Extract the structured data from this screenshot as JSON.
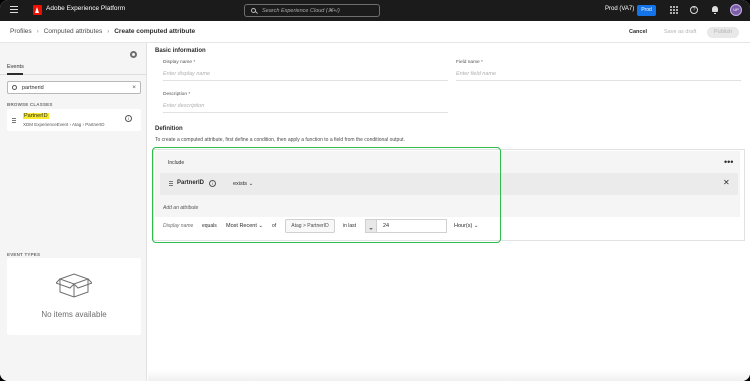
{
  "app": {
    "brand": "Adobe Experience Platform",
    "search_placeholder": "Search Experience Cloud (⌘+/)",
    "org": "Prod (VA7)",
    "sandbox_badge": "Prod",
    "help_glyph": "?",
    "avatar_initials": "UP"
  },
  "breadcrumb": {
    "items": [
      "Profiles",
      "Computed attributes",
      "Create computed attribute"
    ],
    "separator": "›"
  },
  "header_actions": {
    "cancel": "Cancel",
    "save_draft": "Save as draft",
    "publish": "Publish"
  },
  "left_panel": {
    "tab": "Events",
    "search_value": "partnerid",
    "clear_glyph": "×",
    "browse_classes_label": "BROWSE CLASSES",
    "class_item": {
      "name": "PartnerID",
      "path": "XDM ExperienceEvent › Atag › PartnerID",
      "info_glyph": "i"
    },
    "event_types_label": "EVENT TYPES",
    "empty_text": "No items available"
  },
  "form": {
    "basic_info_title": "Basic information",
    "display_name_label": "Display name *",
    "display_name_placeholder": "Enter display name",
    "field_name_label": "Field name *",
    "field_name_placeholder": "Enter field name",
    "description_label": "Description *",
    "description_placeholder": "Enter description",
    "definition_title": "Definition",
    "definition_description": "To create a computed attribute, first define a condition, then apply a function to a field from the conditional output."
  },
  "definition": {
    "include_label": "Include",
    "more_glyph": "•••",
    "condition": {
      "attribute": "PartnerID",
      "info_glyph": "i",
      "operator": "exists",
      "remove_glyph": "✕"
    },
    "add_attribute_placeholder": "Add an attribute",
    "function_row": {
      "display_name_placeholder": "Display name",
      "equals": "equals",
      "function": "Most Recent",
      "of": "of",
      "field": "Atag > PartnerID",
      "in_last": "in last",
      "number": "24",
      "unit": "Hour(s)"
    }
  },
  "colors": {
    "highlight": "#2fbd4a",
    "brand_red": "#eb1000",
    "prod_blue": "#1473e6",
    "search_highlight": "#f6ea2a"
  }
}
